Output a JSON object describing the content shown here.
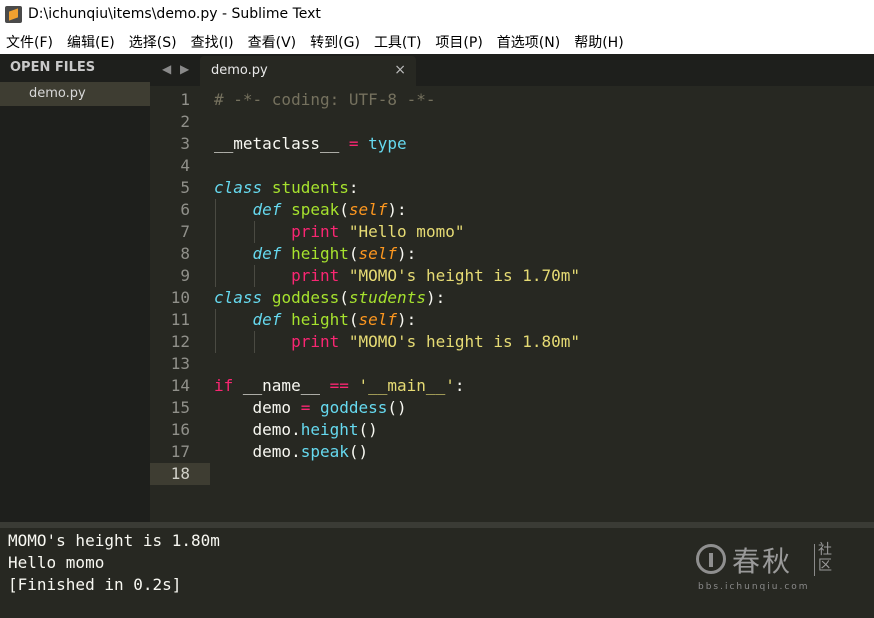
{
  "window": {
    "title": "D:\\ichunqiu\\items\\demo.py - Sublime Text"
  },
  "menu": [
    "文件(F)",
    "编辑(E)",
    "选择(S)",
    "查找(I)",
    "查看(V)",
    "转到(G)",
    "工具(T)",
    "项目(P)",
    "首选项(N)",
    "帮助(H)"
  ],
  "sidebar": {
    "header": "OPEN FILES",
    "files": [
      "demo.py"
    ]
  },
  "tabs": {
    "back_arrow": "◀",
    "forward_arrow": "▶",
    "active": "demo.py",
    "close_glyph": "×"
  },
  "editor": {
    "current_line": 18,
    "line_numbers": [
      "1",
      "2",
      "3",
      "4",
      "5",
      "6",
      "7",
      "8",
      "9",
      "10",
      "11",
      "12",
      "13",
      "14",
      "15",
      "16",
      "17",
      "18"
    ],
    "lines": [
      [
        {
          "t": "# -*- coding: UTF-8 -*-",
          "c": "cm"
        }
      ],
      [],
      [
        {
          "t": "__metaclass__ ",
          "c": ""
        },
        {
          "t": "=",
          "c": "op"
        },
        {
          "t": " ",
          "c": ""
        },
        {
          "t": "type",
          "c": "bi"
        }
      ],
      [],
      [
        {
          "t": "class",
          "c": "kw"
        },
        {
          "t": " ",
          "c": ""
        },
        {
          "t": "students",
          "c": "cls"
        },
        {
          "t": ":",
          "c": ""
        }
      ],
      [
        {
          "t": "    ",
          "c": ""
        },
        {
          "t": "def",
          "c": "kw"
        },
        {
          "t": " ",
          "c": ""
        },
        {
          "t": "speak",
          "c": "fn"
        },
        {
          "t": "(",
          "c": ""
        },
        {
          "t": "self",
          "c": "self"
        },
        {
          "t": "):",
          "c": ""
        }
      ],
      [
        {
          "t": "        ",
          "c": ""
        },
        {
          "t": "print",
          "c": "pr"
        },
        {
          "t": " ",
          "c": ""
        },
        {
          "t": "\"Hello momo\"",
          "c": "str"
        }
      ],
      [
        {
          "t": "    ",
          "c": ""
        },
        {
          "t": "def",
          "c": "kw"
        },
        {
          "t": " ",
          "c": ""
        },
        {
          "t": "height",
          "c": "fn"
        },
        {
          "t": "(",
          "c": ""
        },
        {
          "t": "self",
          "c": "self"
        },
        {
          "t": "):",
          "c": ""
        }
      ],
      [
        {
          "t": "        ",
          "c": ""
        },
        {
          "t": "print",
          "c": "pr"
        },
        {
          "t": " ",
          "c": ""
        },
        {
          "t": "\"MOMO's height is 1.70m\"",
          "c": "str"
        }
      ],
      [
        {
          "t": "class",
          "c": "kw"
        },
        {
          "t": " ",
          "c": ""
        },
        {
          "t": "goddess",
          "c": "cls"
        },
        {
          "t": "(",
          "c": ""
        },
        {
          "t": "students",
          "c": "inh"
        },
        {
          "t": "):",
          "c": ""
        }
      ],
      [
        {
          "t": "    ",
          "c": ""
        },
        {
          "t": "def",
          "c": "kw"
        },
        {
          "t": " ",
          "c": ""
        },
        {
          "t": "height",
          "c": "fn"
        },
        {
          "t": "(",
          "c": ""
        },
        {
          "t": "self",
          "c": "self"
        },
        {
          "t": "):",
          "c": ""
        }
      ],
      [
        {
          "t": "        ",
          "c": ""
        },
        {
          "t": "print",
          "c": "pr"
        },
        {
          "t": " ",
          "c": ""
        },
        {
          "t": "\"MOMO's height is 1.80m\"",
          "c": "str"
        }
      ],
      [],
      [
        {
          "t": "if",
          "c": "op"
        },
        {
          "t": " __name__ ",
          "c": ""
        },
        {
          "t": "==",
          "c": "op"
        },
        {
          "t": " ",
          "c": ""
        },
        {
          "t": "'__main__'",
          "c": "str"
        },
        {
          "t": ":",
          "c": ""
        }
      ],
      [
        {
          "t": "    demo ",
          "c": ""
        },
        {
          "t": "=",
          "c": "op"
        },
        {
          "t": " ",
          "c": ""
        },
        {
          "t": "goddess",
          "c": "ct"
        },
        {
          "t": "()",
          "c": ""
        }
      ],
      [
        {
          "t": "    demo.",
          "c": ""
        },
        {
          "t": "height",
          "c": "ct"
        },
        {
          "t": "()",
          "c": ""
        }
      ],
      [
        {
          "t": "    demo.",
          "c": ""
        },
        {
          "t": "speak",
          "c": "ct"
        },
        {
          "t": "()",
          "c": ""
        }
      ],
      []
    ]
  },
  "output": {
    "lines": [
      "MOMO's height is 1.80m",
      "Hello momo",
      "[Finished in 0.2s]"
    ]
  },
  "watermark": {
    "brand": "春秋",
    "community": "社区",
    "url": "bbs.ichunqiu.com"
  }
}
